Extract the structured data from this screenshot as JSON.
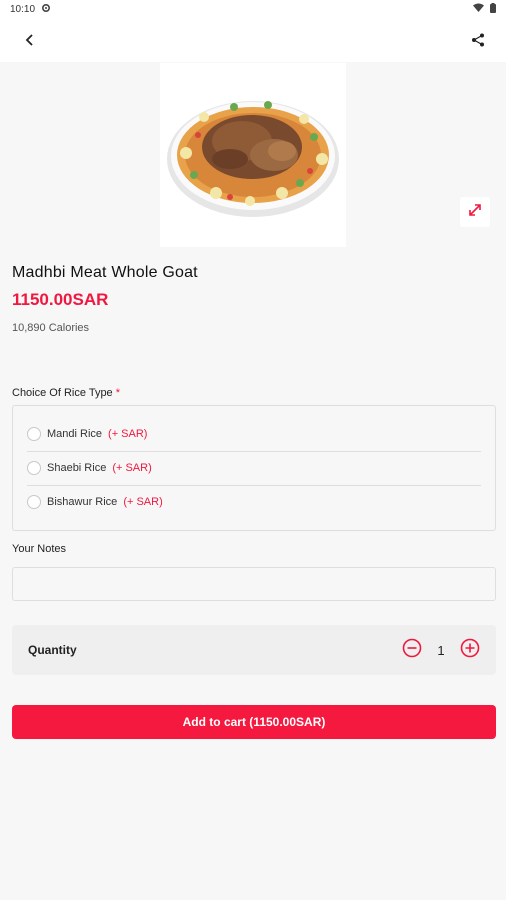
{
  "status_bar": {
    "time": "10:10"
  },
  "product": {
    "title": "Madhbi Meat Whole Goat",
    "price": "1150.00SAR",
    "calories": "10,890 Calories"
  },
  "rice_choice": {
    "label": "Choice Of Rice Type",
    "required_mark": "*",
    "options": [
      {
        "name": "Mandi Rice",
        "extra": "(+ SAR)"
      },
      {
        "name": "Shaebi Rice",
        "extra": "(+ SAR)"
      },
      {
        "name": "Bishawur Rice",
        "extra": "(+ SAR)"
      }
    ]
  },
  "notes": {
    "label": "Your Notes",
    "value": "",
    "placeholder": ""
  },
  "quantity": {
    "label": "Quantity",
    "value": "1"
  },
  "cart_button": {
    "label": "Add to cart (1150.00SAR)"
  },
  "colors": {
    "accent": "#f5183f",
    "background": "#f7f7f7"
  },
  "icons": [
    "settings-icon",
    "wifi-icon",
    "battery-icon",
    "back-arrow-icon",
    "share-icon",
    "expand-icon",
    "minus-circle-icon",
    "plus-circle-icon"
  ]
}
